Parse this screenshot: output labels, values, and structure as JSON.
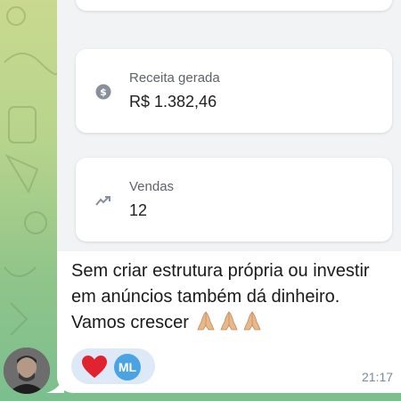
{
  "cards": {
    "receita": {
      "label": "Receita gerada",
      "value": "R$ 1.382,46",
      "icon": "dollar-circle-icon"
    },
    "vendas": {
      "label": "Vendas",
      "value": "12",
      "icon": "trending-up-icon"
    }
  },
  "message": {
    "text": "Sem criar estrutura própria ou investir em anúncios também dá dinheiro. Vamos crescer",
    "emoji_count": 3,
    "emoji": "folded-hands",
    "time": "21:17"
  },
  "reactions": {
    "heart": "red-heart-icon",
    "avatar_initials": "ML"
  },
  "colors": {
    "bubble": "#ffffff",
    "screenshot_bg": "#f1f3f4",
    "reaction_bg": "#dde9f6",
    "avatar_ml": "#4aa3e2",
    "heart": "#e0232e"
  }
}
